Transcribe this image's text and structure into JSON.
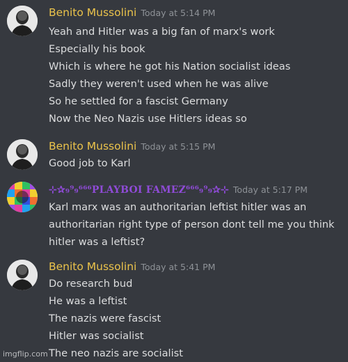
{
  "messages": [
    {
      "author": "Benito Mussolini",
      "timestamp": "Today at 5:14 PM",
      "avatar_icon": "bald-man-avatar-icon",
      "lines": [
        "Yeah and Hitler was a big fan of marx's work",
        "Especially his book",
        "Which is where he got his Nation socialist ideas",
        "Sadly they weren't used when he was alive",
        "So he settled for a fascist Germany",
        "Now the Neo Nazis use Hitlers ideas so"
      ]
    },
    {
      "author": "Benito Mussolini",
      "timestamp": "Today at 5:15 PM",
      "avatar_icon": "bald-man-avatar-icon",
      "lines": [
        "Good job to Karl"
      ]
    },
    {
      "author": "⊹✰₉⁹₉⁶⁶⁶PLAYBOI FAMEZ⁶⁶⁶₉⁹₉✰⊹",
      "timestamp": "Today at 5:17 PM",
      "avatar_icon": "colorful-mosaic-avatar-icon",
      "lines": [
        "Karl marx was an authoritarian leftist hitler was an",
        "authoritarian right type of person dont tell me you think",
        "hitler was a leftist?"
      ]
    },
    {
      "author": "Benito Mussolini",
      "timestamp": "Today at 5:41 PM",
      "avatar_icon": "bald-man-avatar-icon",
      "lines": [
        "Do research bud",
        "He was a leftist",
        "The nazis were fascist",
        "Hitler was socialist",
        "The neo nazis are socialist"
      ]
    }
  ],
  "watermark": "imgflip.com",
  "colors": {
    "background": "#36393f",
    "username_gold": "#ebc34b",
    "username_purple": "#8f4bd7",
    "timestamp": "#8e9297",
    "text": "#dcddde"
  }
}
